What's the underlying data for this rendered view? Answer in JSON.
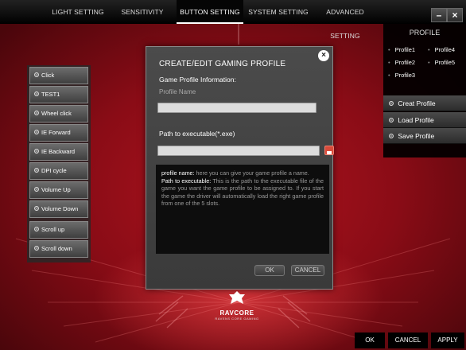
{
  "nav": {
    "tabs": [
      {
        "label": "LIGHT SETTING",
        "active": false
      },
      {
        "label": "SENSITIVITY",
        "active": false
      },
      {
        "label": "BUTTON SETTING",
        "active": true
      },
      {
        "label": "SYSTEM SETTING",
        "active": false
      },
      {
        "label": "ADVANCED SETTING",
        "active": false
      }
    ],
    "minimize_label": "–",
    "close_label": "×"
  },
  "buttons": {
    "items": [
      {
        "label": "Click"
      },
      {
        "label": "TEST1"
      },
      {
        "label": "Wheel click"
      },
      {
        "label": "IE Forward"
      },
      {
        "label": "IE Backward"
      },
      {
        "label": "DPI cycle"
      },
      {
        "label": "Volume Up"
      },
      {
        "label": "Volume Down"
      },
      {
        "label": "Scroll up"
      },
      {
        "label": "Scroll down"
      }
    ]
  },
  "profile": {
    "title": "PROFILE",
    "slots": [
      "Profile1",
      "Profile4",
      "Profile2",
      "Profile5",
      "Profile3"
    ],
    "actions": [
      "Creat Profile",
      "Load Profile",
      "Save Profile"
    ]
  },
  "dialog": {
    "title": "CREATE/EDIT GAMING PROFILE",
    "subtitle": "Game Profile Information:",
    "name_label": "Profile Name",
    "name_value": "",
    "path_label": "Path to executable(*.exe)",
    "path_value": "",
    "help": {
      "name_term": "profile name:",
      "name_text": " here you can give your game profile a name.",
      "path_term": "Path to executable:",
      "path_text": " This is the path to the executable file of the game you want the game profile to be assigned to. If you start the game the driver will automatically load the right game profile from one of the 5 slots."
    },
    "ok_label": "OK",
    "cancel_label": "CANCEL"
  },
  "logo": {
    "name": "RAVCORE",
    "tagline": "RAVENS CORE GAMING"
  },
  "footer": {
    "ok_label": "OK",
    "cancel_label": "CANCEL",
    "apply_label": "APPLY"
  },
  "colors": {
    "background": "#8a0c16",
    "accent": "#d94a3a"
  }
}
